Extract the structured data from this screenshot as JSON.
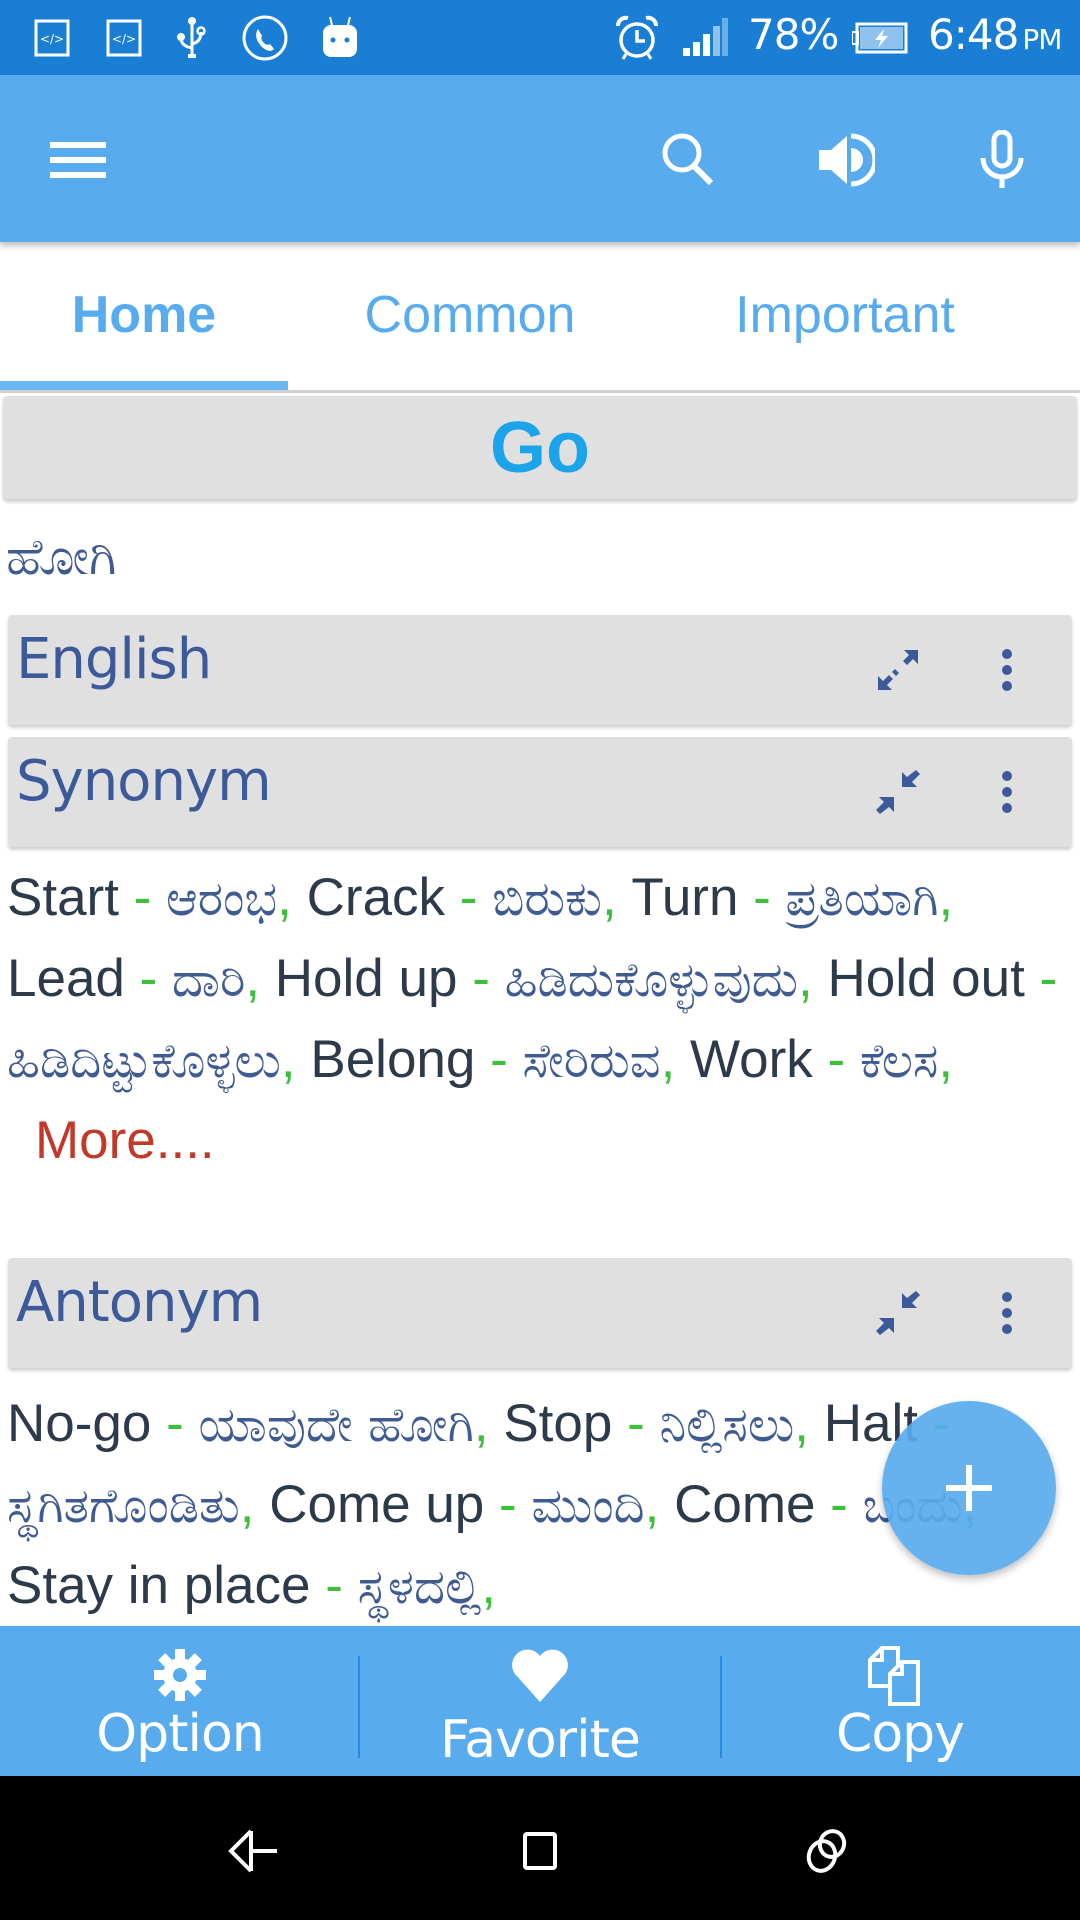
{
  "status_bar": {
    "left_icons": [
      "code-icon",
      "code-icon",
      "usb-icon",
      "phone-call-icon",
      "android-icon"
    ],
    "right_icons": [
      "alarm-icon",
      "signal-icon",
      "battery-charging-icon"
    ],
    "battery": "78%",
    "time": "6:48",
    "ampm": "PM"
  },
  "app_bar": {
    "menu_icon": "hamburger-menu-icon",
    "actions": [
      "search-icon",
      "speaker-icon",
      "microphone-icon"
    ]
  },
  "tabs": [
    {
      "label": "Home",
      "active": true
    },
    {
      "label": "Common",
      "active": false
    },
    {
      "label": "Important",
      "active": false
    }
  ],
  "word": {
    "title": "Go",
    "translation": "ಹೋಗಿ"
  },
  "sections": {
    "english": {
      "title": "English",
      "toggle_icon": "expand-icon",
      "state": "collapsed"
    },
    "synonym": {
      "title": "Synonym",
      "toggle_icon": "collapse-icon",
      "state": "expanded",
      "items": [
        {
          "en": "Start",
          "kn": "ಆರಂಭ"
        },
        {
          "en": "Crack",
          "kn": "ಬಿರುಕು"
        },
        {
          "en": "Turn",
          "kn": "ಪ್ರತಿಯಾಗಿ"
        },
        {
          "en": "Lead",
          "kn": "ದಾರಿ"
        },
        {
          "en": "Hold up",
          "kn": "ಹಿಡಿದುಕೊಳ್ಳುವುದು"
        },
        {
          "en": "Hold out",
          "kn": "ಹಿಡಿದಿಟ್ಟುಕೊಳ್ಳಲು"
        },
        {
          "en": "Belong",
          "kn": "ಸೇರಿರುವ"
        },
        {
          "en": "Work",
          "kn": "ಕೆಲಸ"
        }
      ],
      "more_label": "More...."
    },
    "antonym": {
      "title": "Antonym",
      "toggle_icon": "collapse-icon",
      "state": "expanded",
      "items": [
        {
          "en": "No-go",
          "kn": "ಯಾವುದೇ ಹೋಗಿ"
        },
        {
          "en": "Stop",
          "kn": "ನಿಲ್ಲಿಸಲು"
        },
        {
          "en": "Halt",
          "kn": "ಸ್ಥಗಿತಗೊಂಡಿತು"
        },
        {
          "en": "Come up",
          "kn": "ಮುಂದಿ"
        },
        {
          "en": "Come",
          "kn": "ಬಂದು"
        },
        {
          "en": "Stay in place",
          "kn": "ಸ್ಥಳದಲ್ಲಿ"
        }
      ]
    }
  },
  "separator": " - ",
  "comma": ",",
  "fab": {
    "icon": "plus-icon"
  },
  "bottom_bar": [
    {
      "label": "Option",
      "icon": "gear-icon"
    },
    {
      "label": "Favorite",
      "icon": "heart-icon"
    },
    {
      "label": "Copy",
      "icon": "copy-icon"
    }
  ],
  "nav_bar": [
    "back-icon",
    "home-icon",
    "recents-icon"
  ],
  "colors": {
    "status_bar": "#1a7fd4",
    "primary": "#58abed",
    "word_title": "#1ca4ea",
    "kannada_text": "#3f5b91",
    "separator": "#3cc03c",
    "more_link": "#c0392b",
    "section_bg": "#e0e0e0"
  }
}
